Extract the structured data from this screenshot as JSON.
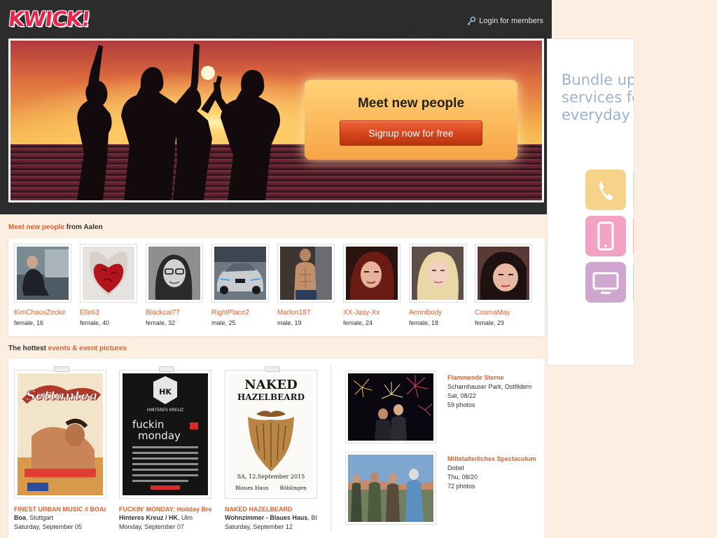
{
  "header": {
    "logo": "KWICK!",
    "login_label": "Login for members"
  },
  "banner": {
    "cta_title": "Meet new people",
    "cta_button": "Signup now for free"
  },
  "people_section": {
    "title_highlight": "Meet new people",
    "title_rest": " from Aalen",
    "people": [
      {
        "name": "KimChaosZecke",
        "info": "female, 16"
      },
      {
        "name": "Elle63",
        "info": "female, 40"
      },
      {
        "name": "Blackcat77",
        "info": "female, 32"
      },
      {
        "name": "RightPlace2",
        "info": "male, 25"
      },
      {
        "name": "Marlon187",
        "info": "male, 19"
      },
      {
        "name": "XX-Jasy-Xx",
        "info": "female, 24"
      },
      {
        "name": "Aennibody",
        "info": "female, 18"
      },
      {
        "name": "CosmaMay",
        "info": "female, 29"
      }
    ]
  },
  "events_section": {
    "title_rest": "The hottest ",
    "title_highlight": "events & event pictures",
    "events": [
      {
        "title": "FINEST URBAN MUSIC // BOA//",
        "place_bold": "Boa",
        "place_rest": ", Stuttgart",
        "date": "Saturday, September 05"
      },
      {
        "title": "FUCKIN' MONDAY: Holiday Break",
        "place_bold": "Hinteres Kreuz / HK",
        "place_rest": ", Ulm",
        "date": "Monday, September 07"
      },
      {
        "title": "NAKED HAZELBEARD",
        "place_bold": "Wohnzimmer - Blaues Haus",
        "place_rest": ", Böblingen",
        "date": "Saturday, September 12"
      }
    ],
    "posters": {
      "poster3_title1": "NAKED",
      "poster3_title2": "HAZELBEARD",
      "poster3_date": "SA, 12.September 2015",
      "poster3_place1": "Blaues Haus",
      "poster3_place2": "Böblingen",
      "poster2_main": "fuckin",
      "poster2_main2": "monday",
      "poster2_badge": "HK",
      "poster2_sub": "HINTERES KREUZ",
      "poster1_main": "Settantea"
    },
    "galleries": [
      {
        "title": "Flammende Sterne",
        "place": "Scharnhauser Park, Ostfildern",
        "date": "Sat, 08/22",
        "photos": "59 photos"
      },
      {
        "title": "Mittelalterliches Spectaculum",
        "place": "Dobel",
        "date": "Thu, 08/20",
        "photos": "72 photos"
      }
    ]
  },
  "ad": {
    "line1": "Bundle up",
    "line2": "services for",
    "line3": "everyday p",
    "colors": {
      "phone": "#f7d38a",
      "mobile": "#f2a3c4",
      "tv": "#cfa6cf"
    }
  },
  "colors": {
    "accent": "#e2602a",
    "header_bg": "#2b2b2b",
    "page_bg": "#fcefe2"
  }
}
